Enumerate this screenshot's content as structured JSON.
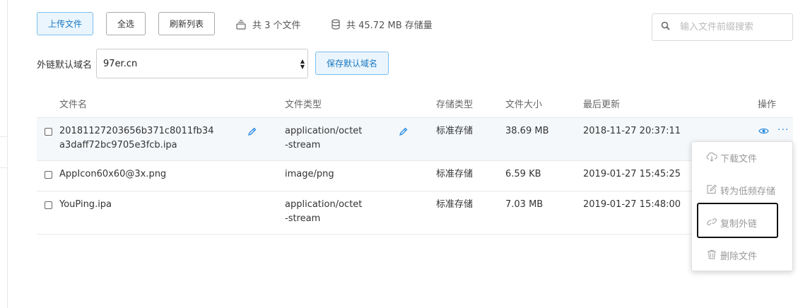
{
  "toolbar": {
    "upload_label": "上传文件",
    "select_all_label": "全选",
    "refresh_label": "刷新列表",
    "file_count_text": "共 3 个文件",
    "storage_text": "共 45.72 MB 存储量"
  },
  "search": {
    "placeholder": "输入文件前缀搜索"
  },
  "domain": {
    "label": "外链默认域名",
    "selected_value": "97er.cn",
    "save_label": "保存默认域名"
  },
  "table": {
    "headers": {
      "name": "文件名",
      "type": "文件类型",
      "storage": "存储类型",
      "size": "文件大小",
      "updated": "最后更新",
      "actions": "操作"
    },
    "rows": [
      {
        "name_line1": "20181127203656b371c8011fb34",
        "name_line2": "a3daff72bc9705e3fcb.ipa",
        "type_line1": "application/octet",
        "type_line2": "-stream",
        "storage": "标准存储",
        "size": "38.69 MB",
        "updated": "2018-11-27 20:37:11"
      },
      {
        "name_line1": "AppIcon60x60@3x.png",
        "name_line2": "",
        "type_line1": "image/png",
        "type_line2": "",
        "storage": "标准存储",
        "size": "6.59 KB",
        "updated": "2019-01-27 15:45:25"
      },
      {
        "name_line1": "YouPing.ipa",
        "name_line2": "",
        "type_line1": "application/octet",
        "type_line2": "-stream",
        "storage": "标准存储",
        "size": "7.03 MB",
        "updated": "2019-01-27 15:48:00"
      }
    ]
  },
  "actions_menu": {
    "items": [
      {
        "label": "下载文件",
        "icon": "cloud-download-icon"
      },
      {
        "label": "转为低频存储",
        "icon": "edit-square-icon"
      },
      {
        "label": "复制外链",
        "icon": "link-icon"
      },
      {
        "label": "删除文件",
        "icon": "trash-icon"
      }
    ]
  },
  "colors": {
    "primary": "#1a78c2",
    "primary_bg": "#eaf5fd",
    "icon_blue": "#2a8be0",
    "row_highlight": "#f5f8fb"
  }
}
